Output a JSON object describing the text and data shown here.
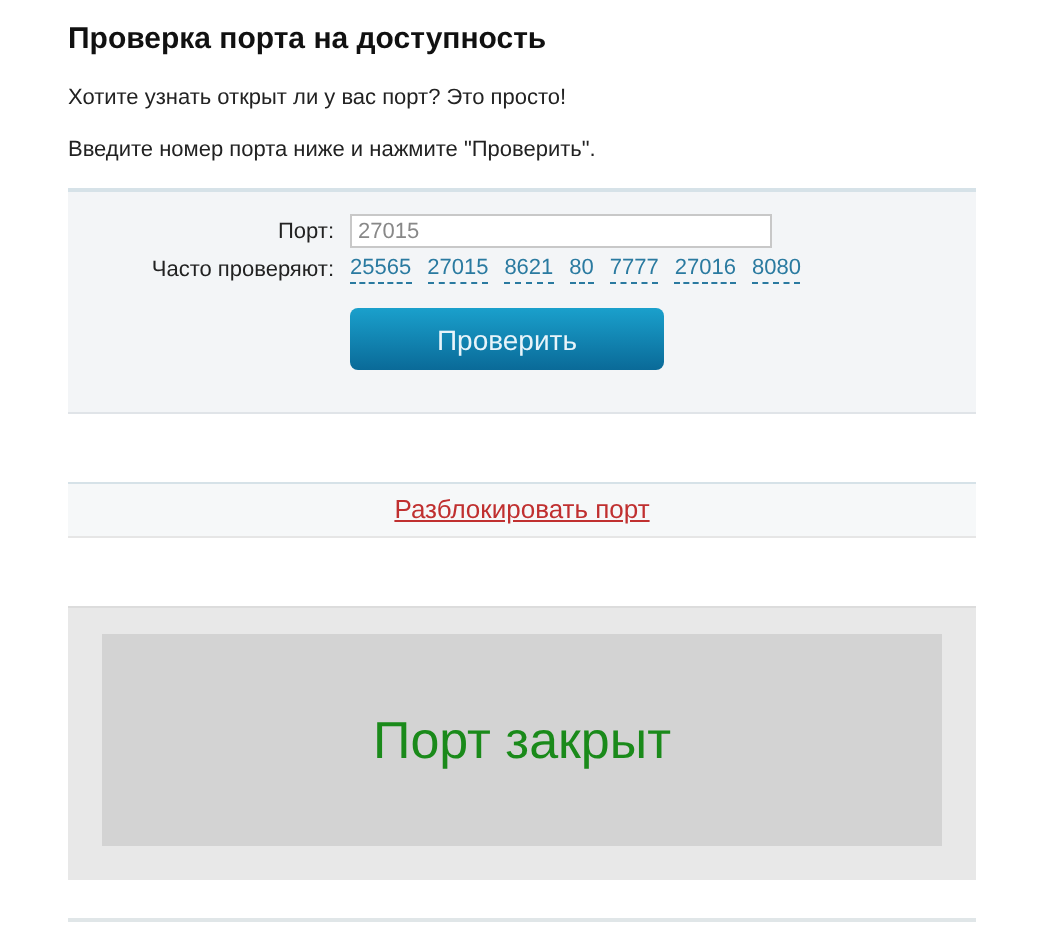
{
  "heading": "Проверка порта на доступность",
  "intro": [
    "Хотите узнать открыт ли у вас порт? Это просто!",
    "Введите номер порта ниже и нажмите \"Проверить\"."
  ],
  "form": {
    "port_label": "Порт:",
    "port_value": "27015",
    "frequent_label": "Часто проверяют:",
    "frequent_ports": [
      "25565",
      "27015",
      "8621",
      "80",
      "7777",
      "27016",
      "8080"
    ],
    "button": "Проверить"
  },
  "unblock_link": "Разблокировать порт",
  "result": {
    "text": "Порт закрыт"
  }
}
